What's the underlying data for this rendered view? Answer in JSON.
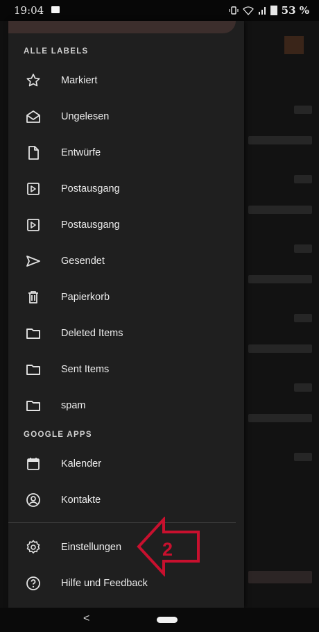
{
  "status_bar": {
    "time": "19:04",
    "battery": "53 %"
  },
  "drawer": {
    "labels_header": "ALLE LABELS",
    "labels": [
      {
        "label": "Markiert",
        "icon": "star-icon"
      },
      {
        "label": "Ungelesen",
        "icon": "envelope-open-icon"
      },
      {
        "label": "Entwürfe",
        "icon": "draft-icon"
      },
      {
        "label": "Postausgang",
        "icon": "outbox-icon"
      },
      {
        "label": "Postausgang",
        "icon": "outbox-icon"
      },
      {
        "label": "Gesendet",
        "icon": "send-icon"
      },
      {
        "label": "Papierkorb",
        "icon": "trash-icon"
      },
      {
        "label": "Deleted Items",
        "icon": "folder-icon"
      },
      {
        "label": "Sent Items",
        "icon": "folder-icon"
      },
      {
        "label": "spam",
        "icon": "folder-icon"
      }
    ],
    "apps_header": "GOOGLE APPS",
    "apps": [
      {
        "label": "Kalender",
        "icon": "calendar-icon"
      },
      {
        "label": "Kontakte",
        "icon": "contacts-icon"
      }
    ],
    "footer": [
      {
        "label": "Einstellungen",
        "icon": "gear-icon"
      },
      {
        "label": "Hilfe und Feedback",
        "icon": "help-icon"
      }
    ]
  },
  "annotation": {
    "number": "2",
    "color": "#c8102e"
  },
  "nav_bar": {
    "back_glyph": "<"
  }
}
